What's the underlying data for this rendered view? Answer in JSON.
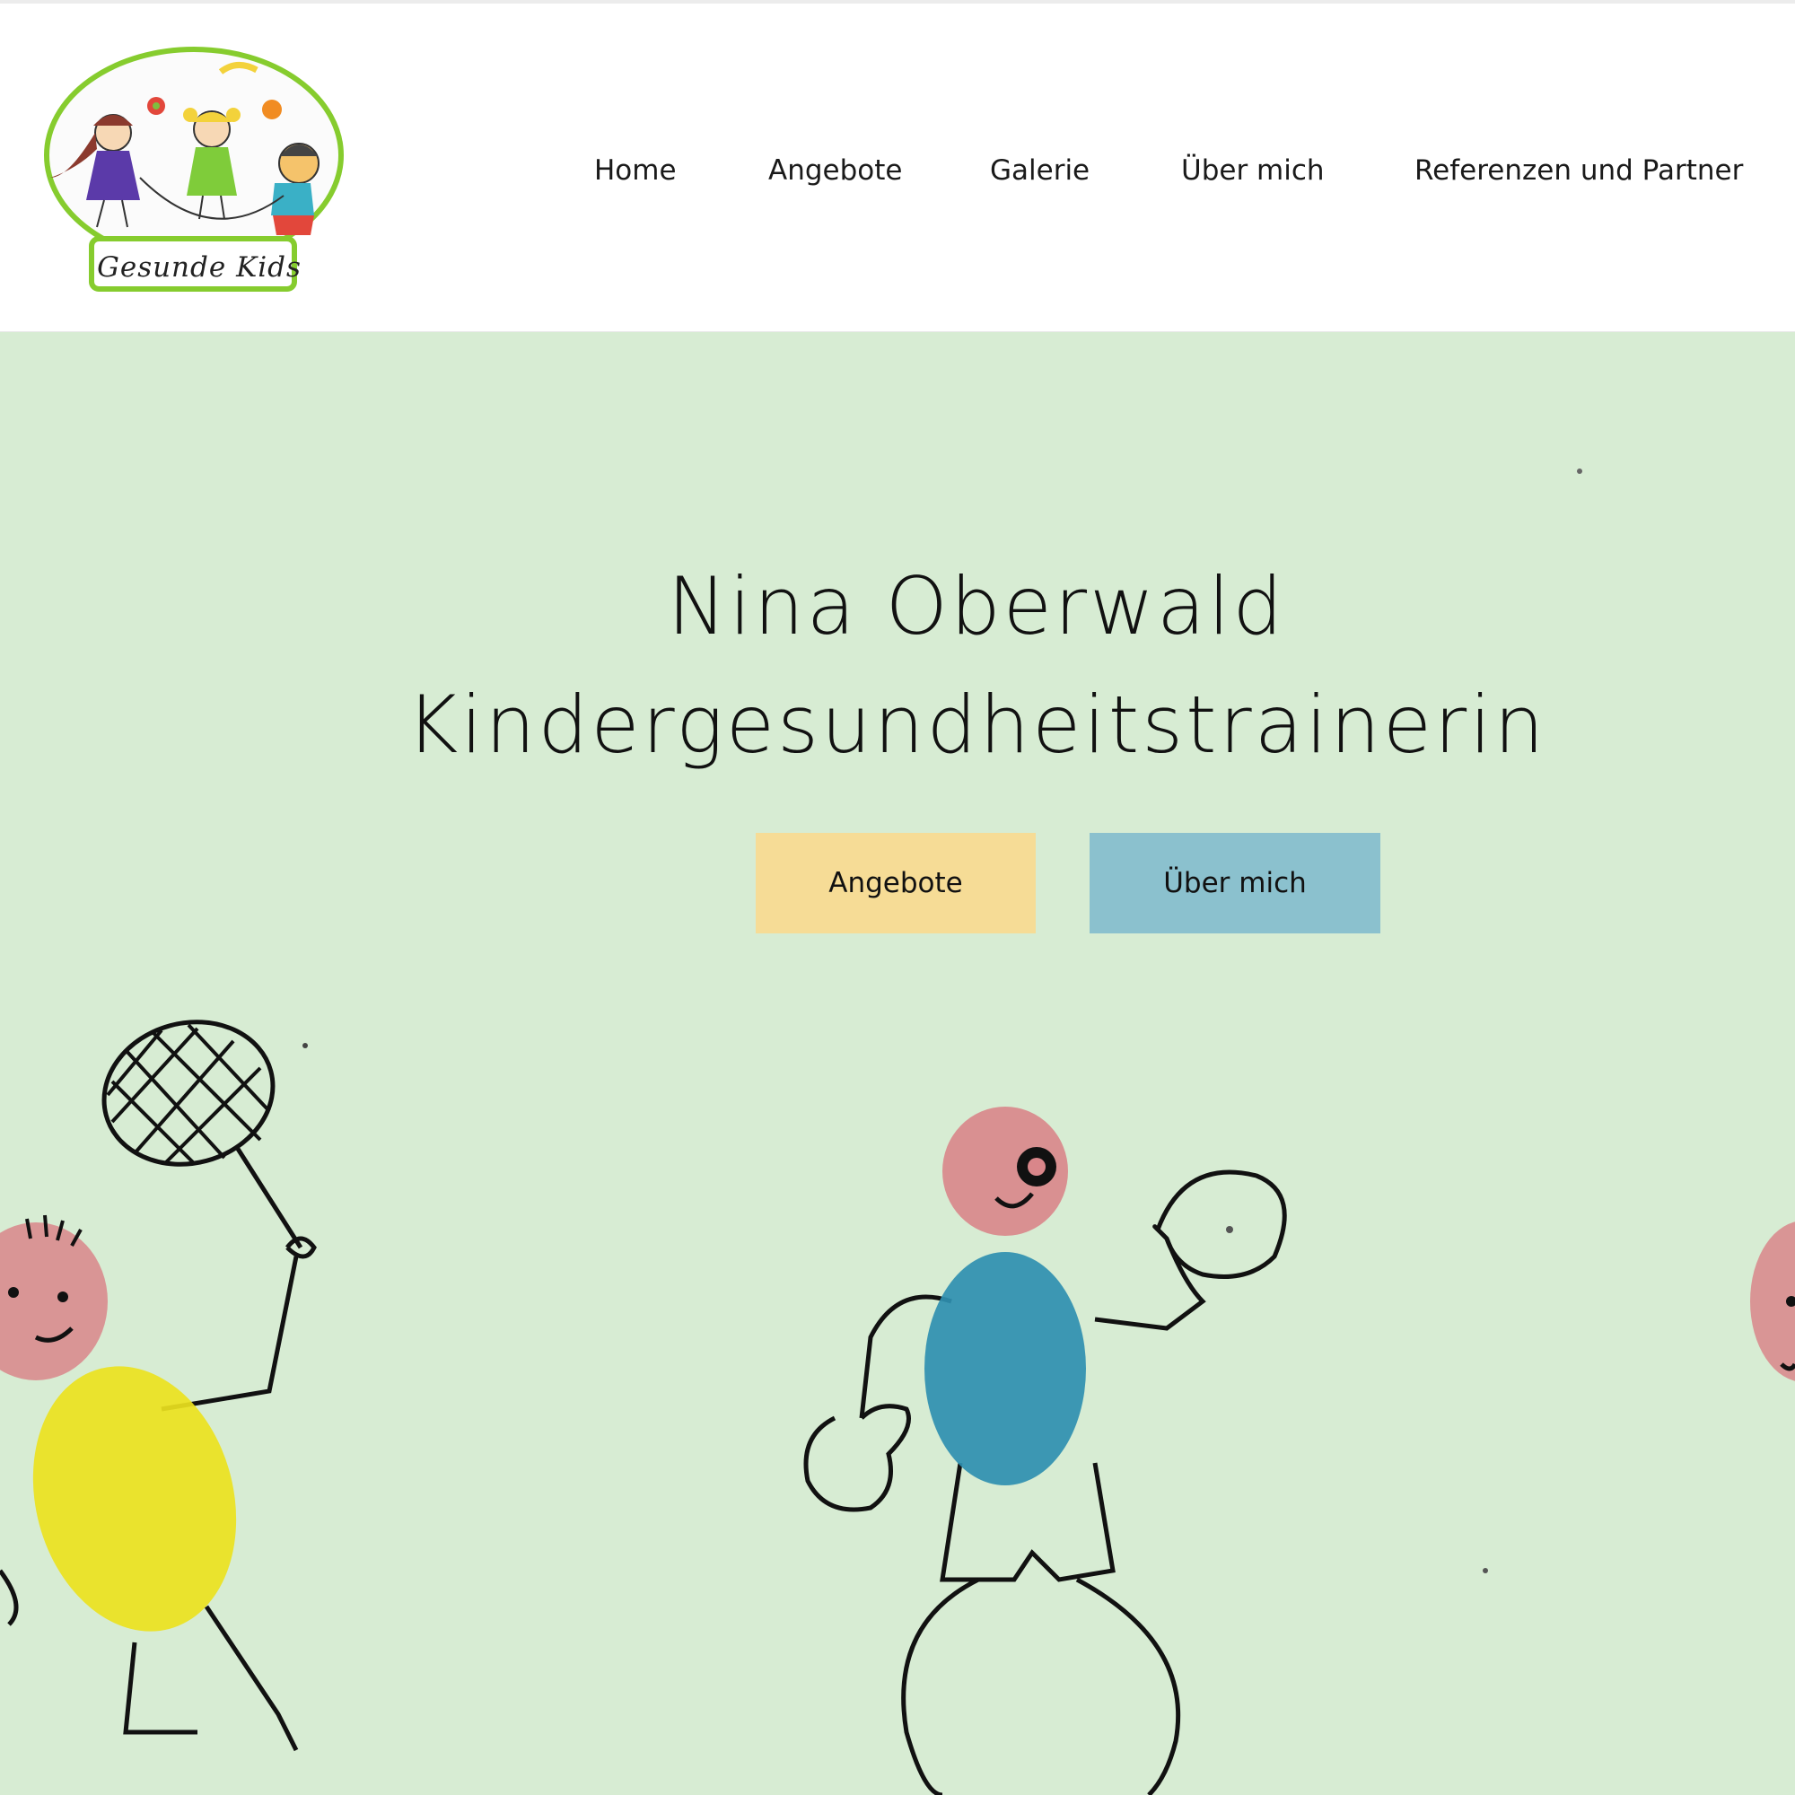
{
  "brand": {
    "logo_text": "Gesunde Kids",
    "accent_green": "#86cc2e"
  },
  "nav": {
    "items": [
      {
        "label": "Home"
      },
      {
        "label": "Angebote"
      },
      {
        "label": "Galerie"
      },
      {
        "label": "Über mich"
      },
      {
        "label": "Referenzen und Partner"
      }
    ]
  },
  "hero": {
    "title_line1": "Nina Oberwald",
    "title_line2": "Kindergesundheitstrainerin",
    "background_color": "#d7ecd3",
    "buttons": [
      {
        "label": "Angebote",
        "color": "#f6dc96"
      },
      {
        "label": "Über mich",
        "color": "#8bc1ce"
      }
    ]
  }
}
